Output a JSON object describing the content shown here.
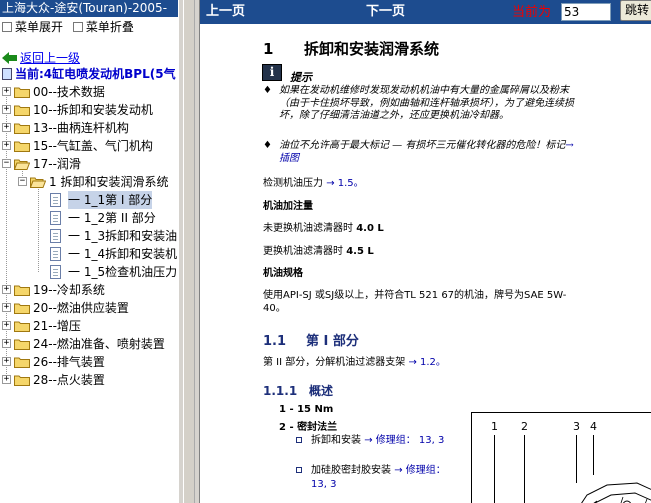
{
  "left_pane": {
    "title": "上海大众-途安(Touran)-2005-",
    "expand_all": "菜单展开",
    "collapse_all": "菜单折叠",
    "back_link": "返回上一级",
    "current": "当前:4缸电喷发动机BPL(5气",
    "tree": [
      {
        "label": "00--技术数据",
        "level": 0,
        "type": "folder",
        "expanded": false
      },
      {
        "label": "10--拆卸和安装发动机",
        "level": 0,
        "type": "folder",
        "expanded": false
      },
      {
        "label": "13--曲柄连杆机构",
        "level": 0,
        "type": "folder",
        "expanded": false
      },
      {
        "label": "15--气缸盖、气门机构",
        "level": 0,
        "type": "folder",
        "expanded": false
      },
      {
        "label": "17--润滑",
        "level": 0,
        "type": "folder",
        "expanded": true
      },
      {
        "label": "1 拆卸和安装润滑系统",
        "level": 1,
        "type": "folder",
        "expanded": true
      },
      {
        "label": "一 1_1第 I 部分",
        "level": 2,
        "type": "doc",
        "selected": true
      },
      {
        "label": "一 1_2第 II 部分",
        "level": 2,
        "type": "doc"
      },
      {
        "label": "一 1_3拆卸和安装油",
        "level": 2,
        "type": "doc"
      },
      {
        "label": "一 1_4拆卸和安装机",
        "level": 2,
        "type": "doc"
      },
      {
        "label": "一 1_5检查机油压力",
        "level": 2,
        "type": "doc"
      },
      {
        "label": "19--冷却系统",
        "level": 0,
        "type": "folder",
        "expanded": false
      },
      {
        "label": "20--燃油供应装置",
        "level": 0,
        "type": "folder",
        "expanded": false
      },
      {
        "label": "21--增压",
        "level": 0,
        "type": "folder",
        "expanded": false
      },
      {
        "label": "24--燃油准备、喷射装置",
        "level": 0,
        "type": "folder",
        "expanded": false
      },
      {
        "label": "26--排气装置",
        "level": 0,
        "type": "folder",
        "expanded": false
      },
      {
        "label": "28--点火装置",
        "level": 0,
        "type": "folder",
        "expanded": false
      }
    ]
  },
  "toolbar": {
    "prev": "上一页",
    "next": "下一页",
    "current_label": "当前为",
    "page_value": "53",
    "jump": "跳转"
  },
  "content": {
    "h1_num": "1",
    "h1_text": "拆卸和安装润滑系统",
    "note_title": "提示",
    "notes": [
      {
        "text": "如果在发动机维修时发现发动机机油中有大量的金属碎屑以及粉末（由于卡住损坏导致，例如曲轴和连杆轴承损坏），为了避免连续损坏，除了仔细清洁油道之外，还应更换机油冷却器。"
      },
      {
        "text": "油位不允许高于最大标记 — 有损坏三元催化转化器的危险！标记",
        "link": "→ 插图"
      }
    ],
    "check_pressure": {
      "text": "检测机油压力",
      "link": "→ 1.5。"
    },
    "fill_title": "机油加注量",
    "fill_rows": [
      {
        "label": "未更换机油滤清器时",
        "value": "4.0 L"
      },
      {
        "label": "更换机油滤清器时",
        "value": "4.5 L"
      }
    ],
    "spec_title": "机油规格",
    "spec_text": "使用API-SJ 或SJ级以上，并符合TL 521 67的机油，牌号为SAE 5W-40。",
    "h2_num": "1.1",
    "h2_text": "第 I 部分",
    "part2_text": "第 II 部分，分解机油过滤器支架",
    "part2_link": "→ 1.2。",
    "h3_num": "1.1.1",
    "h3_text": "概述",
    "items": [
      {
        "num": "1 -",
        "text": "15 Nm"
      },
      {
        "num": "2 -",
        "text": "密封法兰"
      }
    ],
    "sub_items": [
      {
        "text": "拆卸和安装",
        "link": "→ 修理组： 13, 3"
      },
      {
        "text": "加硅胶密封胶安装",
        "link": "→ 修理组： 13, 3"
      }
    ],
    "diagram_callouts": [
      "1",
      "2",
      "3",
      "4"
    ]
  }
}
